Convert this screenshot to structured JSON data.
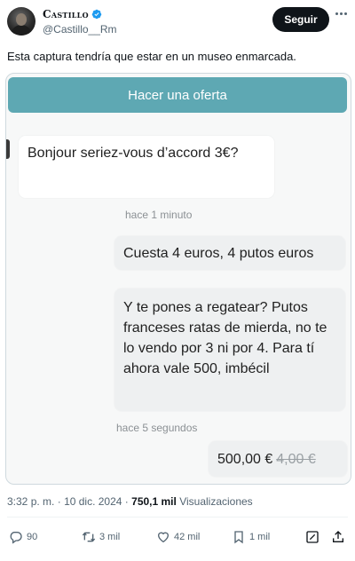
{
  "author": {
    "display_name": "Castillo",
    "handle": "@Castillo__Rm",
    "follow_label": "Seguir"
  },
  "tweet": {
    "text": "Esta captura tendría que estar en un museo enmarcada."
  },
  "media": {
    "offer_button": "Hacer una oferta",
    "messages": [
      {
        "text": "Bonjour seriez-vous d’accord 3€?"
      },
      {
        "text": "Cuesta 4 euros, 4 putos euros"
      },
      {
        "text": "Y te pones a regatear? Putos franceses ratas de mierda, no te lo vendo por 3 ni por 4. Para tí ahora vale 500, imbécil"
      }
    ],
    "time_1": "hace 1 minuto",
    "time_2": "hace 5 segundos",
    "price_new": "500,00 €",
    "price_old": "4,00 €"
  },
  "meta": {
    "time": "3:32 p. m.",
    "sep1": "·",
    "date": "10 dic. 2024",
    "sep2": "·",
    "views_count": "750,1 mil",
    "views_label": "Visualizaciones"
  },
  "actions": {
    "replies": "90",
    "retweets": "3 mil",
    "likes": "42 mil",
    "bookmarks": "1 mil"
  },
  "colors": {
    "offer_bar": "#5ea8b3",
    "verified": "#1d9bf0",
    "text_primary": "#0f1419",
    "text_secondary": "#536471"
  },
  "icons": [
    "verified-badge-icon",
    "more-icon",
    "reply-icon",
    "retweet-icon",
    "like-icon",
    "bookmark-icon",
    "edit-icon",
    "share-icon"
  ]
}
